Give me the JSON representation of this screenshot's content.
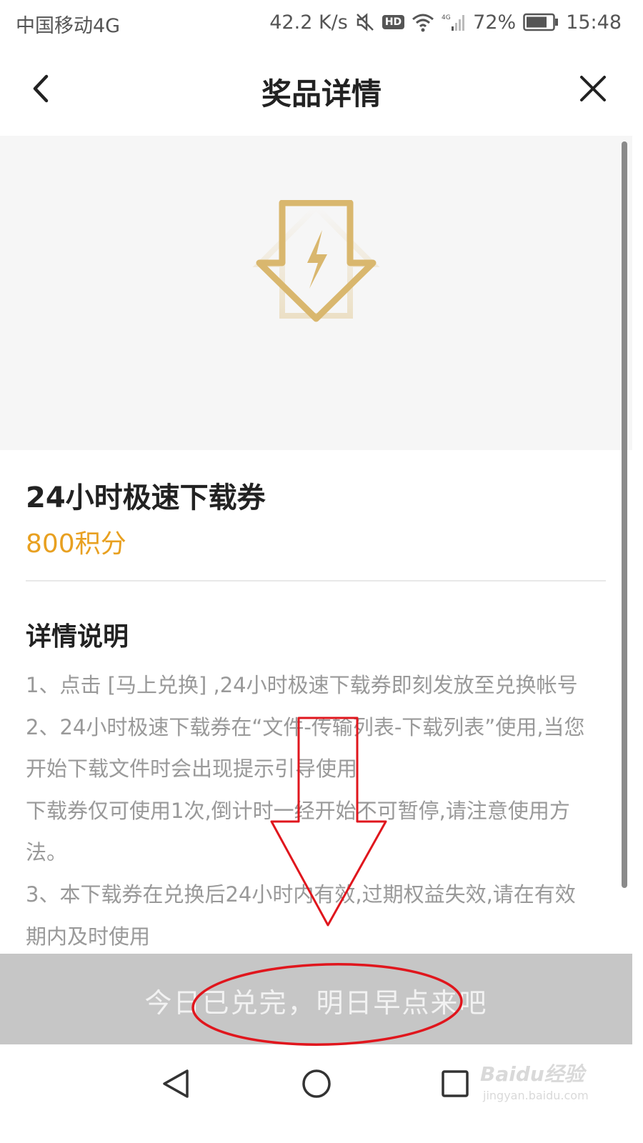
{
  "status_bar": {
    "carrier": "中国移动4G",
    "network_speed": "42.2 K/s",
    "hd_label": "HD",
    "battery": "72%",
    "time": "15:48"
  },
  "header": {
    "title": "奖品详情"
  },
  "prize": {
    "name": "24小时极速下载券",
    "points": "800积分"
  },
  "details": {
    "title": "详情说明",
    "lines": [
      "1、点击 [马上兑换] ,24小时极速下载券即刻发放至兑换帐号",
      "2、24小时极速下载券在“文件-传输列表-下载列表”使用,当您",
      "开始下载文件时会出现提示引导使用",
      "下载券仅可使用1次,倒计时一经开始不可暂停,请注意使用方",
      "法。",
      "3、本下载券在兑换后24小时内有效,过期权益失效,请在有效",
      "期内及时使用"
    ]
  },
  "exchange_button": {
    "label": "今日已兑完，明日早点来吧"
  },
  "watermark": {
    "brand": "Baidu经验",
    "url": "jingyan.baidu.com"
  },
  "colors": {
    "accent_gold": "#e8a020",
    "icon_gold": "#d9b76e",
    "annotation_red": "#e0161d"
  }
}
